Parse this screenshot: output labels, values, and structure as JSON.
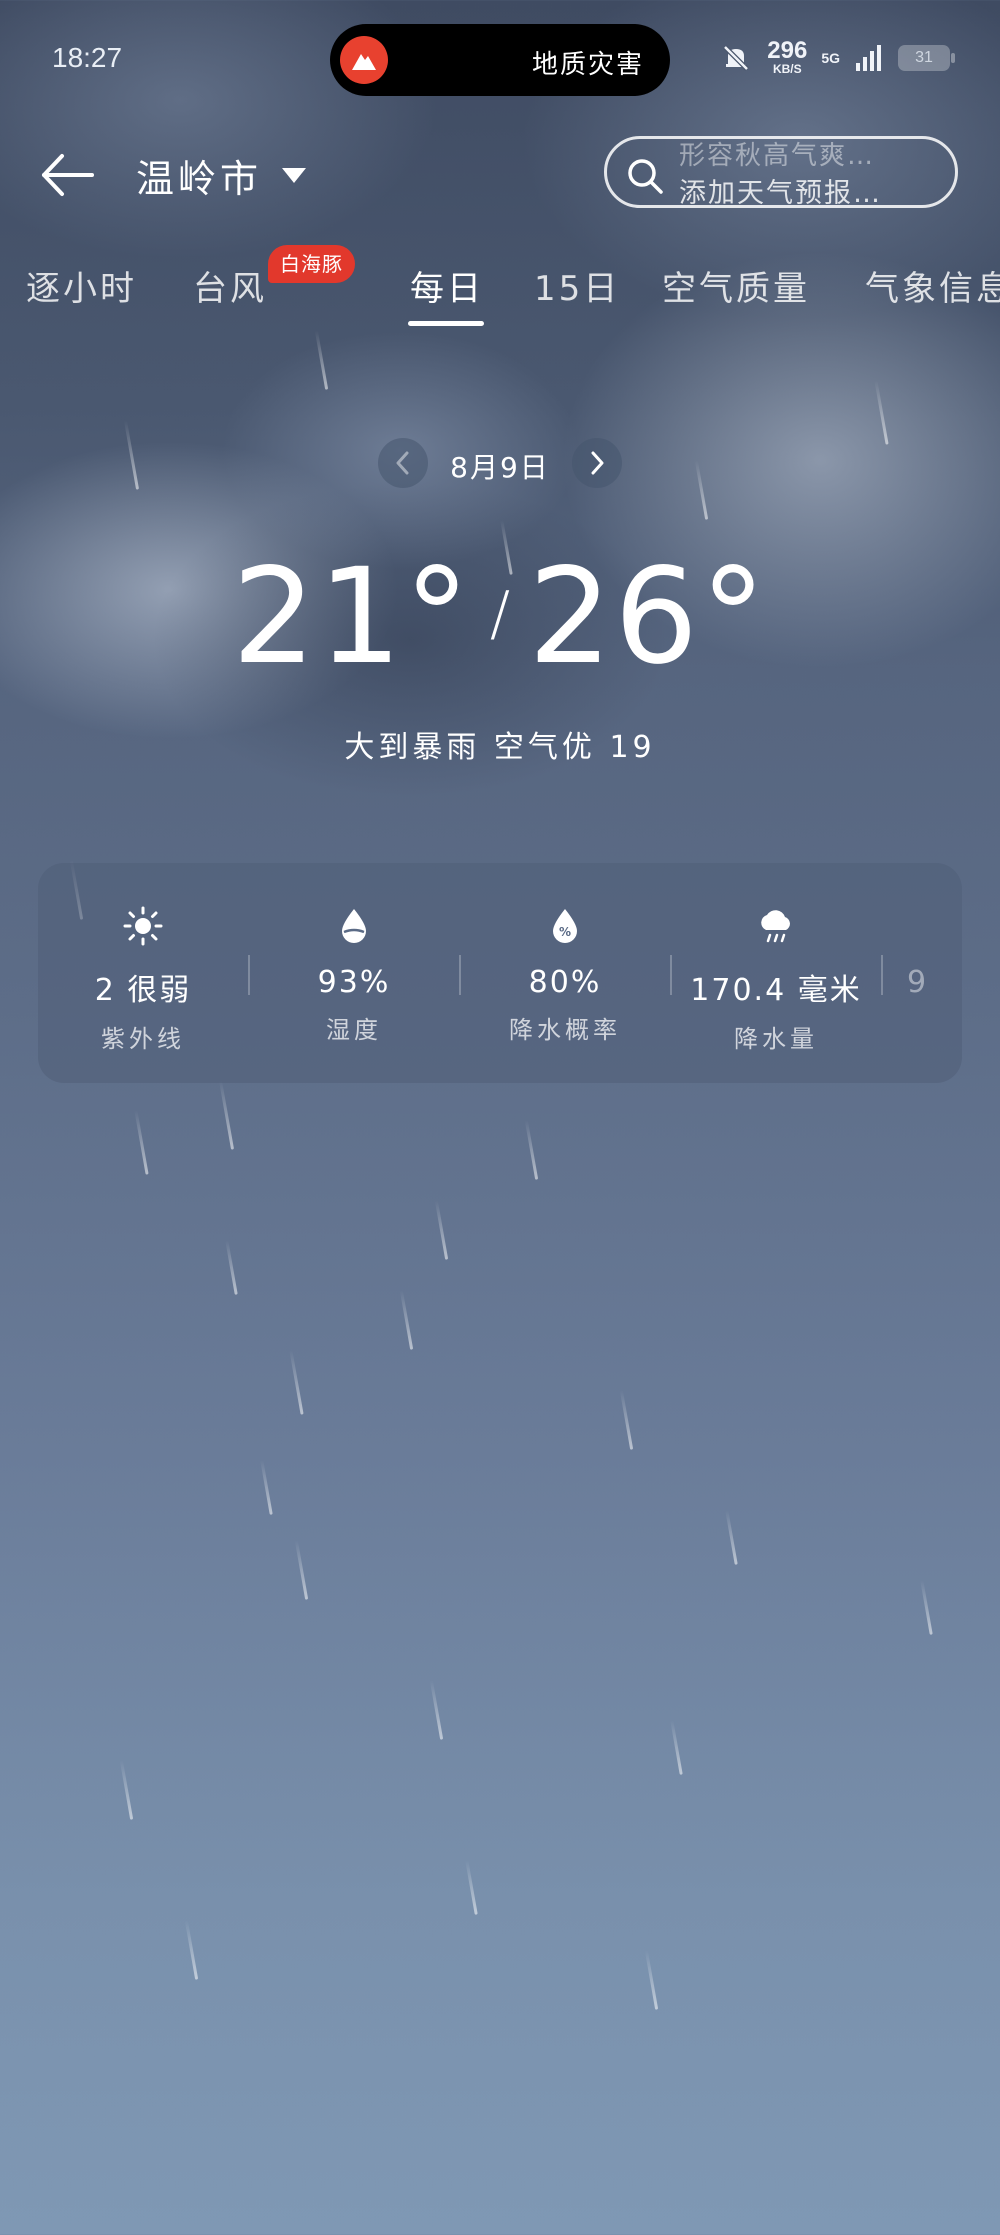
{
  "status_bar": {
    "time": "18:27",
    "alert_text": "地质灾害",
    "net_speed": "296",
    "net_speed_unit": "KB/S",
    "network": "5G",
    "battery": "31"
  },
  "header": {
    "back_icon": "arrow-left-icon",
    "city": "温岭市",
    "search_placeholder_top": "形容秋高气爽…",
    "search_placeholder": "添加天气预报…"
  },
  "tabs": [
    {
      "label": "逐小时"
    },
    {
      "label": "台风"
    },
    {
      "label": "每日",
      "active": true
    },
    {
      "label": "15日"
    },
    {
      "label": "空气质量"
    },
    {
      "label": "气象信息"
    }
  ],
  "typhoon_badge": "白海豚",
  "date_nav": {
    "label": "8月9日"
  },
  "forecast": {
    "low": "21°",
    "high": "26°",
    "separator": "/",
    "condition": "大到暴雨 空气优 19"
  },
  "metrics": [
    {
      "icon": "sun-icon",
      "value": "2 很弱",
      "label": "紫外线"
    },
    {
      "icon": "humidity-drop-icon",
      "value": "93%",
      "label": "湿度"
    },
    {
      "icon": "rain-percent-icon",
      "value": "80%",
      "label": "降水概率"
    },
    {
      "icon": "rain-cloud-icon",
      "value": "170.4 毫米",
      "label": "降水量"
    },
    {
      "icon": "partial-icon",
      "value": "9",
      "label": ""
    }
  ],
  "colors": {
    "accent_red": "#e2382c",
    "background_top": "#3f4b62",
    "background_bottom": "#7f98b4"
  }
}
